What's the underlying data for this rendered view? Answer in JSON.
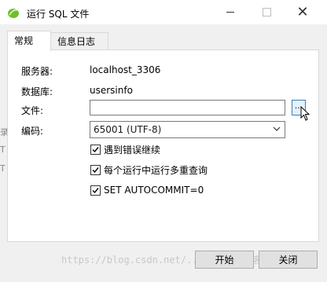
{
  "window": {
    "title": "运行 SQL 文件"
  },
  "tabs": [
    {
      "label": "常规"
    },
    {
      "label": "信息日志"
    }
  ],
  "form": {
    "server_label": "服务器:",
    "server_value": "localhost_3306",
    "database_label": "数据库:",
    "database_value": "usersinfo",
    "file_label": "文件:",
    "file_value": "",
    "browse_label": "...",
    "encoding_label": "编码:",
    "encoding_value": "65001 (UTF-8)"
  },
  "options": [
    {
      "label": "遇到错误继续",
      "checked": true
    },
    {
      "label": "每个运行中运行多重查询",
      "checked": true
    },
    {
      "label": "SET AUTOCOMMIT=0",
      "checked": true
    }
  ],
  "buttons": {
    "start": "开始",
    "close": "关闭"
  },
  "watermark": "https://blog.csdn.net/...   @51CTO博客",
  "left_edge": {
    "a": "录",
    "b": "T",
    "c": "T"
  },
  "colors": {
    "icon_green": "#6fbf2a",
    "accent": "#3c7fb1"
  }
}
